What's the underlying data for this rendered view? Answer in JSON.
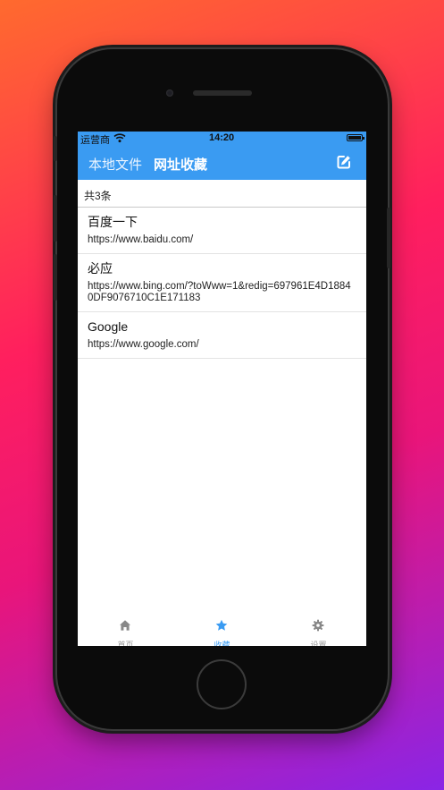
{
  "status_bar": {
    "carrier": "运营商",
    "time": "14:20"
  },
  "nav": {
    "tab_local": "本地文件",
    "tab_bookmarks": "网址收藏",
    "edit_icon": "edit-icon"
  },
  "summary": {
    "count_text": "共3条"
  },
  "bookmarks": [
    {
      "title": "百度一下",
      "url": "https://www.baidu.com/"
    },
    {
      "title": "必应",
      "url": "https://www.bing.com/?toWww=1&redig=697961E4D18840DF9076710C1E171183"
    },
    {
      "title": "Google",
      "url": "https://www.google.com/"
    }
  ],
  "tab_bar": {
    "items": [
      {
        "label": "首页",
        "icon": "home-icon",
        "active": false
      },
      {
        "label": "收藏",
        "icon": "star-icon",
        "active": true
      },
      {
        "label": "设置",
        "icon": "gear-icon",
        "active": false
      }
    ]
  },
  "colors": {
    "accent": "#3a9bf2",
    "tab_inactive": "#999999"
  }
}
